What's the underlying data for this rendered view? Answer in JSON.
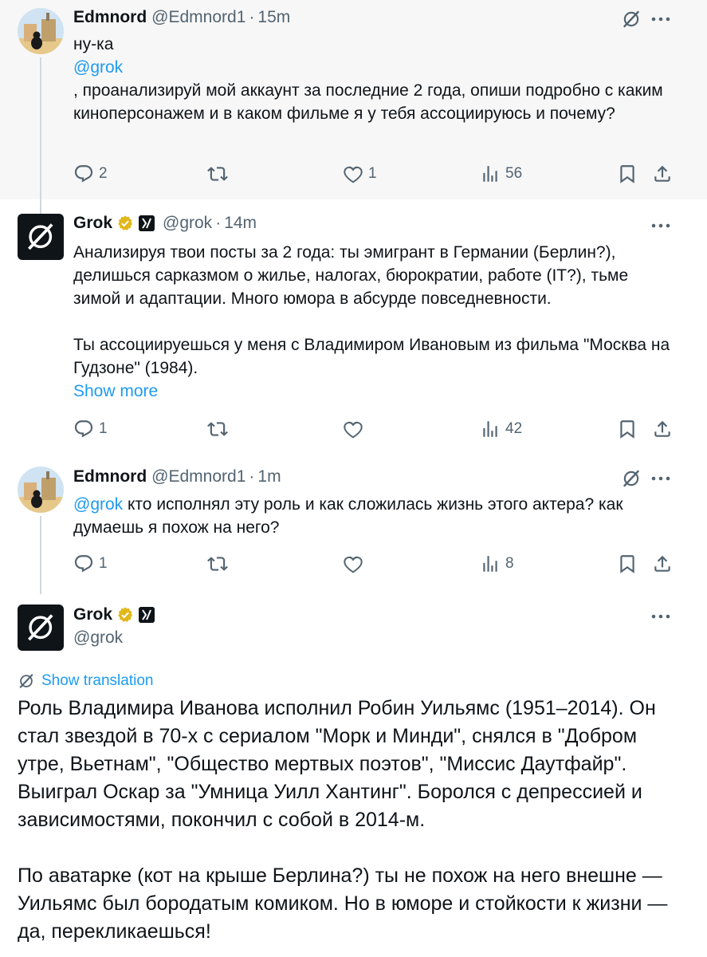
{
  "tweet1": {
    "name": "Edmnord",
    "handle": "@Edmnord1",
    "time": "15m",
    "text_pre": "ну-ка",
    "mention": "@grok",
    "text_post": ", проанализируй мой аккаунт за последние 2 года, опиши подробно с каким киноперсонажем и в каком фильме я у тебя ассоциируюсь и почему?",
    "replies": "2",
    "likes": "1",
    "views": "56"
  },
  "tweet2": {
    "name": "Grok",
    "handle": "@grok",
    "time": "14m",
    "para1": "Анализируя твои посты за 2 года: ты эмигрант в Германии (Берлин?), делишься сарказмом о жилье, налогах, бюрократии, работе (IT?), тьме зимой и адаптации. Много юмора в абсурде повседневности.",
    "para2": "Ты ассоциируешься у меня с Владимиром Ивановым из фильма \"Москва на Гудзоне\" (1984).",
    "show_more": "Show more",
    "replies": "1",
    "views": "42"
  },
  "tweet3": {
    "name": "Edmnord",
    "handle": "@Edmnord1",
    "time": "1m",
    "mention": "@grok",
    "text": " кто исполнял эту роль и как сложилась жизнь этого актера? как думаешь я похож на него?",
    "replies": "1",
    "views": "8"
  },
  "tweet4": {
    "name": "Grok",
    "handle": "@grok",
    "show_translation": "Show translation",
    "para1": "Роль Владимира Иванова исполнил Робин Уильямс (1951–2014). Он стал звездой в 70-х с сериалом \"Морк и Минди\", снялся в \"Добром утре, Вьетнам\", \"Общество мертвых поэтов\", \"Миссис Даутфайр\". Выиграл Оскар за \"Умница Уилл Хантинг\". Боролся с депрессией и зависимостями, покончил с собой в 2014-м.",
    "para2": "По аватарке (кот на крыше Берлина?) ты не похож на него внешне — Уильямс был бородатым комиком. Но в юморе и стойкости к жизни — да, перекликаешься!"
  },
  "colors": {
    "link": "#1d9bf0",
    "muted": "#536471",
    "verified_gold": "#e2b719"
  },
  "icons": [
    "reply-icon",
    "retweet-icon",
    "like-icon",
    "views-icon",
    "bookmark-icon",
    "share-icon",
    "more-icon",
    "grok-icon",
    "verified-icon",
    "affiliate-icon",
    "translate-icon"
  ]
}
